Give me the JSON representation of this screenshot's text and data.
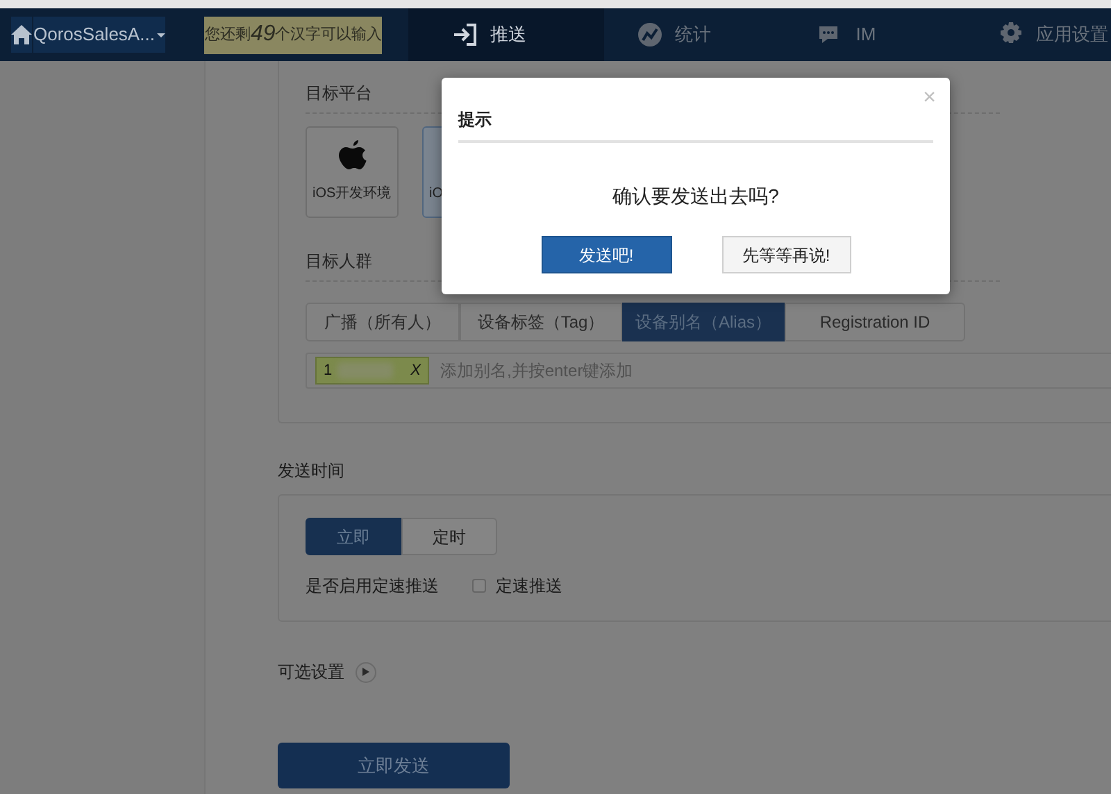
{
  "nav": {
    "app_name": "QorosSalesA...",
    "notice": {
      "before": "您还剩",
      "count": "49",
      "after": "个汉字可以输入"
    },
    "tabs": [
      {
        "label": "推送",
        "selected": true
      },
      {
        "label": "统计",
        "selected": false
      },
      {
        "label": "IM",
        "selected": false
      },
      {
        "label": "应用设置",
        "selected": false
      }
    ]
  },
  "target_platform": {
    "label": "目标平台",
    "platforms": [
      {
        "label": "iOS开发环境",
        "selected": false
      },
      {
        "label": "iO",
        "selected": true
      }
    ]
  },
  "target_audience": {
    "label": "目标人群",
    "tabs": [
      {
        "label": "广播（所有人）",
        "selected": false
      },
      {
        "label": "设备标签（Tag）",
        "selected": false
      },
      {
        "label": "设备别名（Alias）",
        "selected": true
      },
      {
        "label": "Registration ID",
        "selected": false
      }
    ],
    "alias_tag": "1",
    "alias_placeholder": "添加别名,并按enter键添加",
    "remove_tag": "X"
  },
  "send_time": {
    "label": "发送时间",
    "options": [
      {
        "label": "立即",
        "selected": true
      },
      {
        "label": "定时",
        "selected": false
      }
    ],
    "rate_label": "是否启用定速推送",
    "rate_checkbox": {
      "label": "定速推送",
      "checked": false
    }
  },
  "optional_settings": {
    "label": "可选设置",
    "expanded": false
  },
  "submit": "立即发送",
  "dialog": {
    "title": "提示",
    "close": "×",
    "message": "确认要发送出去吗?",
    "confirm": "发送吧!",
    "cancel": "先等等再说!"
  }
}
